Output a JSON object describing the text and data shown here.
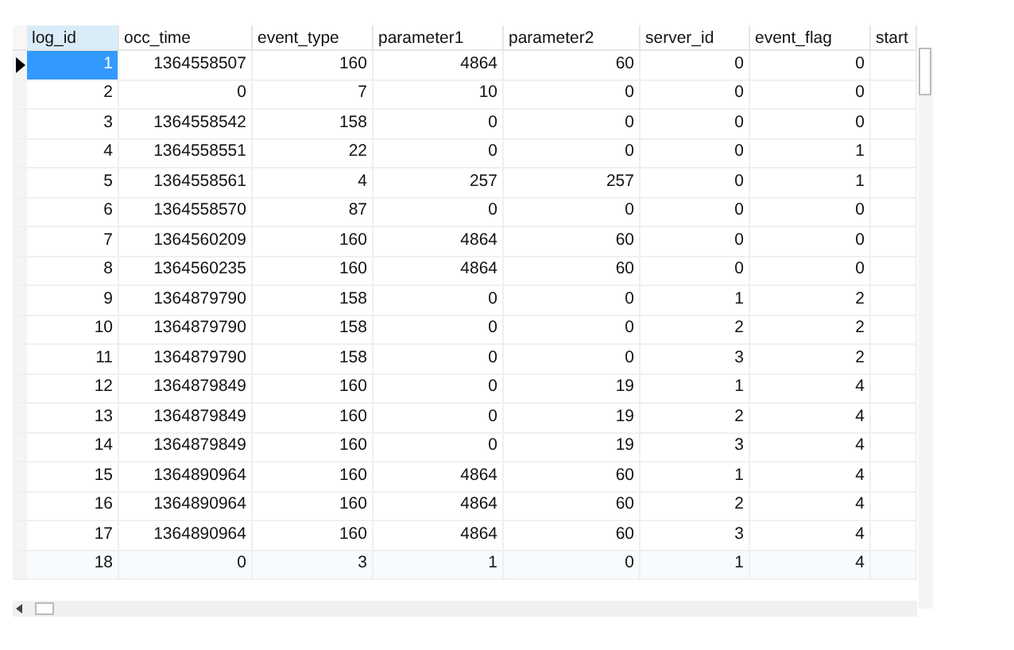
{
  "table": {
    "columns": [
      "log_id",
      "occ_time",
      "event_type",
      "parameter1",
      "parameter2",
      "server_id",
      "event_flag",
      "start"
    ],
    "rows": [
      {
        "selected": true,
        "cells": [
          "1",
          "1364558507",
          "160",
          "4864",
          "60",
          "0",
          "0"
        ]
      },
      {
        "selected": false,
        "cells": [
          "2",
          "0",
          "7",
          "10",
          "0",
          "0",
          "0"
        ]
      },
      {
        "selected": false,
        "cells": [
          "3",
          "1364558542",
          "158",
          "0",
          "0",
          "0",
          "0"
        ]
      },
      {
        "selected": false,
        "cells": [
          "4",
          "1364558551",
          "22",
          "0",
          "0",
          "0",
          "1"
        ]
      },
      {
        "selected": false,
        "cells": [
          "5",
          "1364558561",
          "4",
          "257",
          "257",
          "0",
          "1"
        ]
      },
      {
        "selected": false,
        "cells": [
          "6",
          "1364558570",
          "87",
          "0",
          "0",
          "0",
          "0"
        ]
      },
      {
        "selected": false,
        "cells": [
          "7",
          "1364560209",
          "160",
          "4864",
          "60",
          "0",
          "0"
        ]
      },
      {
        "selected": false,
        "cells": [
          "8",
          "1364560235",
          "160",
          "4864",
          "60",
          "0",
          "0"
        ]
      },
      {
        "selected": false,
        "cells": [
          "9",
          "1364879790",
          "158",
          "0",
          "0",
          "1",
          "2"
        ]
      },
      {
        "selected": false,
        "cells": [
          "10",
          "1364879790",
          "158",
          "0",
          "0",
          "2",
          "2"
        ]
      },
      {
        "selected": false,
        "cells": [
          "11",
          "1364879790",
          "158",
          "0",
          "0",
          "3",
          "2"
        ]
      },
      {
        "selected": false,
        "cells": [
          "12",
          "1364879849",
          "160",
          "0",
          "19",
          "1",
          "4"
        ]
      },
      {
        "selected": false,
        "cells": [
          "13",
          "1364879849",
          "160",
          "0",
          "19",
          "2",
          "4"
        ]
      },
      {
        "selected": false,
        "cells": [
          "14",
          "1364879849",
          "160",
          "0",
          "19",
          "3",
          "4"
        ]
      },
      {
        "selected": false,
        "cells": [
          "15",
          "1364890964",
          "160",
          "4864",
          "60",
          "1",
          "4"
        ]
      },
      {
        "selected": false,
        "cells": [
          "16",
          "1364890964",
          "160",
          "4864",
          "60",
          "2",
          "4"
        ]
      },
      {
        "selected": false,
        "cells": [
          "17",
          "1364890964",
          "160",
          "4864",
          "60",
          "3",
          "4"
        ]
      },
      {
        "selected": false,
        "cells": [
          "18",
          "0",
          "3",
          "1",
          "0",
          "1",
          "4"
        ]
      }
    ]
  }
}
